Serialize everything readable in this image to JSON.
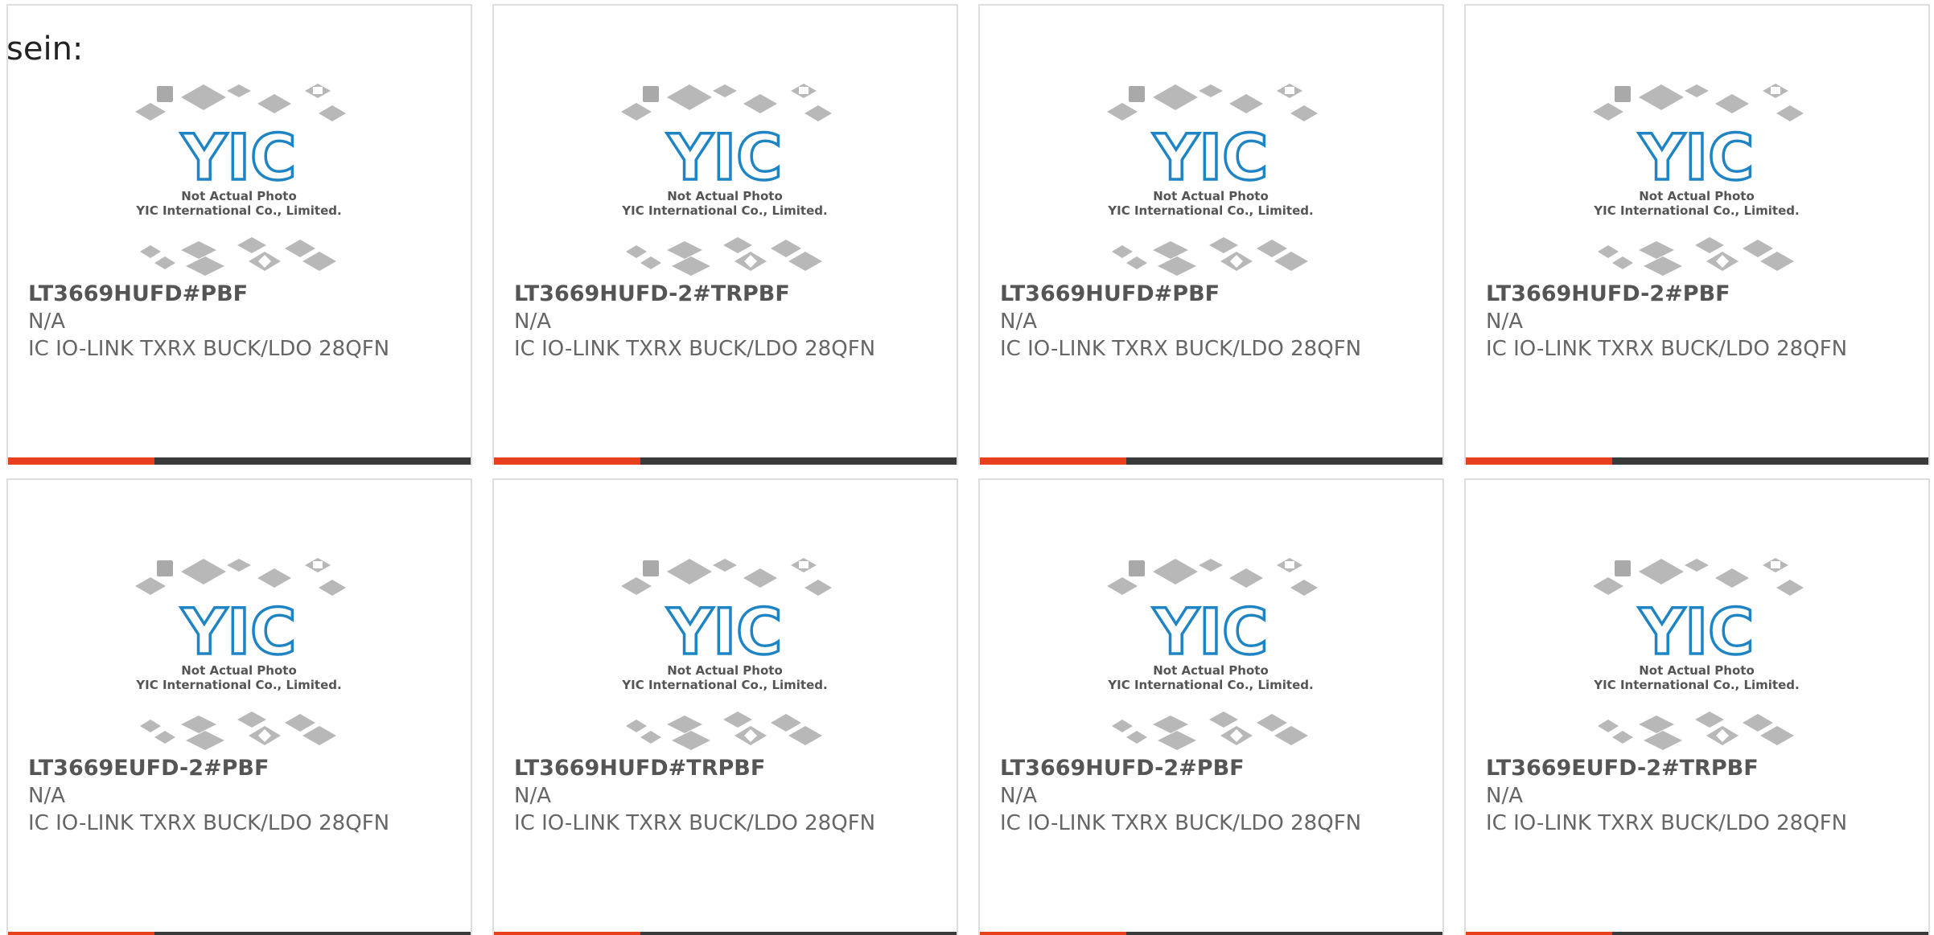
{
  "lead_text": "sein:",
  "placeholder_image": {
    "line1": "Not Actual Photo",
    "line2": "YIC International Co., Limited.",
    "logo_text": "YIC",
    "logo_color": "#1f84c4",
    "chip_color": "#b8b8b8"
  },
  "colors": {
    "accent_bar": "#e8401c",
    "bar": "#3a3a3a",
    "border": "#dedede",
    "text": "#666666"
  },
  "products": [
    {
      "part_number": "LT3669HUFD#PBF",
      "manufacturer": "N/A",
      "description": "IC IO-LINK TXRX BUCK/LDO 28QFN"
    },
    {
      "part_number": "LT3669HUFD-2#TRPBF",
      "manufacturer": "N/A",
      "description": "IC IO-LINK TXRX BUCK/LDO 28QFN"
    },
    {
      "part_number": "LT3669HUFD#PBF",
      "manufacturer": "N/A",
      "description": "IC IO-LINK TXRX BUCK/LDO 28QFN"
    },
    {
      "part_number": "LT3669HUFD-2#PBF",
      "manufacturer": "N/A",
      "description": "IC IO-LINK TXRX BUCK/LDO 28QFN"
    },
    {
      "part_number": "LT3669EUFD-2#PBF",
      "manufacturer": "N/A",
      "description": "IC IO-LINK TXRX BUCK/LDO 28QFN"
    },
    {
      "part_number": "LT3669HUFD#TRPBF",
      "manufacturer": "N/A",
      "description": "IC IO-LINK TXRX BUCK/LDO 28QFN"
    },
    {
      "part_number": "LT3669HUFD-2#PBF",
      "manufacturer": "N/A",
      "description": "IC IO-LINK TXRX BUCK/LDO 28QFN"
    },
    {
      "part_number": "LT3669EUFD-2#TRPBF",
      "manufacturer": "N/A",
      "description": "IC IO-LINK TXRX BUCK/LDO 28QFN"
    }
  ]
}
